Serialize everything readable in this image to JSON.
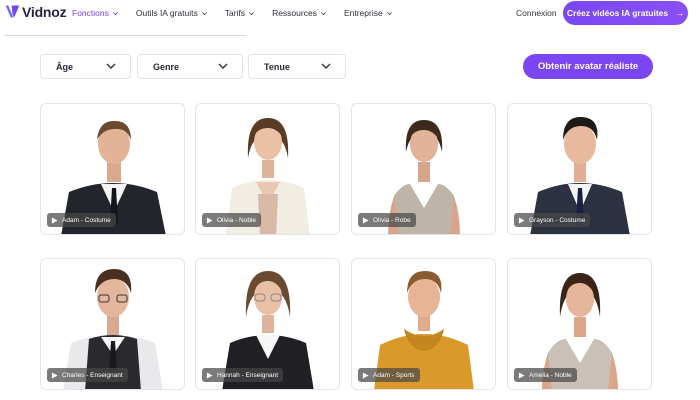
{
  "brand": {
    "name": "Vidnoz",
    "accent": "#7a47f2"
  },
  "nav": {
    "items": [
      {
        "label": "Fonctions",
        "active": true
      },
      {
        "label": "Outils IA gratuits",
        "active": false
      },
      {
        "label": "Tarifs",
        "active": false
      },
      {
        "label": "Ressources",
        "active": false
      },
      {
        "label": "Entreprise",
        "active": false
      }
    ],
    "login": "Connexion",
    "cta": "Créez vidéos IA gratuites",
    "cta_icon": "arrow-right-icon"
  },
  "filters": [
    {
      "label": "Âge"
    },
    {
      "label": "Genre"
    },
    {
      "label": "Tenue"
    }
  ],
  "realistic_button": "Obtenir avatar réaliste",
  "avatars": [
    {
      "label": "Adam - Costume",
      "icon": "play-icon"
    },
    {
      "label": "Olivia - Noble",
      "icon": "play-icon"
    },
    {
      "label": "Olivia - Robe",
      "icon": "play-icon"
    },
    {
      "label": "Grayson - Costume",
      "icon": "play-icon"
    },
    {
      "label": "Charles - Enseignant",
      "icon": "play-icon"
    },
    {
      "label": "Hannah - Enseignant",
      "icon": "play-icon"
    },
    {
      "label": "Adam - Sports",
      "icon": "play-icon"
    },
    {
      "label": "Amelia - Noble",
      "icon": "play-icon"
    }
  ]
}
